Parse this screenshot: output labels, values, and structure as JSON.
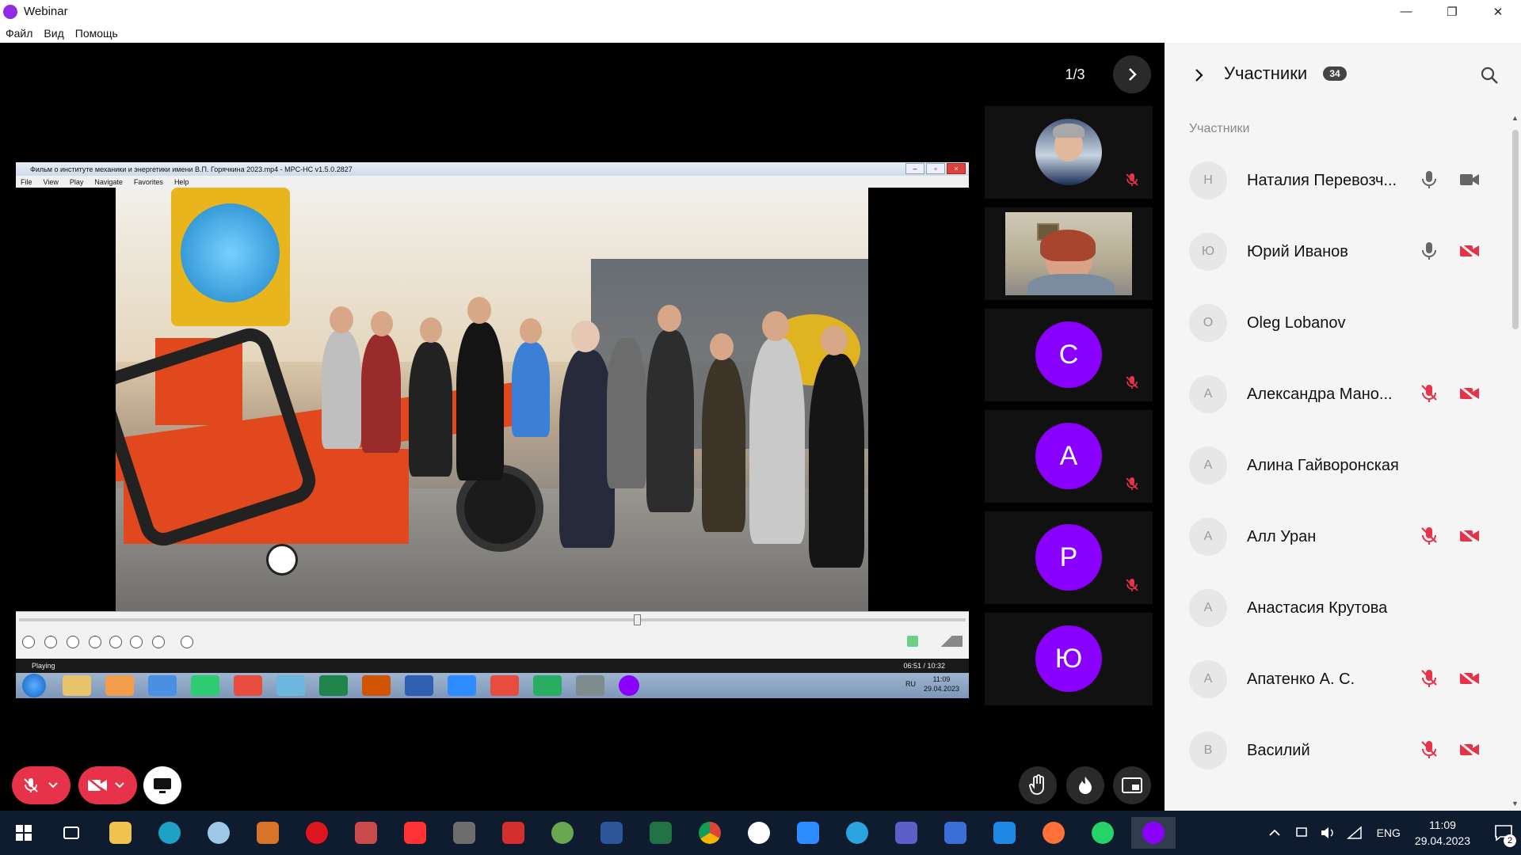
{
  "window": {
    "title": "Webinar",
    "min": "—",
    "max": "❐",
    "close": "✕"
  },
  "menu": [
    "Файл",
    "Вид",
    "Помощь"
  ],
  "gallery": {
    "page": "1/3"
  },
  "shared_screen": {
    "player_title": "Фильм о институте механики и энергетики имени В.П. Горячкина 2023.mp4 - MPC-HC v1.5.0.2827",
    "menu": [
      "File",
      "View",
      "Play",
      "Navigate",
      "Favorites",
      "Help"
    ],
    "status_left": "Playing",
    "status_right": "06:51 / 10:32",
    "seek_position": 0.649,
    "tray_lang": "RU",
    "tray_time": "11:09",
    "tray_date": "29.04.2023"
  },
  "tiles": [
    {
      "kind": "photo",
      "muted": true
    },
    {
      "kind": "camera",
      "muted": false
    },
    {
      "kind": "avatar",
      "letter": "С",
      "muted": true
    },
    {
      "kind": "avatar",
      "letter": "А",
      "muted": true
    },
    {
      "kind": "avatar",
      "letter": "Р",
      "muted": true
    },
    {
      "kind": "avatar",
      "letter": "Ю",
      "muted": false
    }
  ],
  "sidebar": {
    "title": "Участники",
    "count": "34",
    "section": "Участники",
    "participants": [
      {
        "initial": "Н",
        "name": "Наталия Перевозч...",
        "mic": "on",
        "cam": "on"
      },
      {
        "initial": "Ю",
        "name": "Юрий Иванов",
        "mic": "on",
        "cam": "off"
      },
      {
        "initial": "O",
        "name": "Oleg Lobanov",
        "mic": "none",
        "cam": "none"
      },
      {
        "initial": "А",
        "name": "Александра Мано...",
        "mic": "off",
        "cam": "off"
      },
      {
        "initial": "А",
        "name": "Алина Гайворонская",
        "mic": "none",
        "cam": "none"
      },
      {
        "initial": "А",
        "name": "Алл Уран",
        "mic": "off",
        "cam": "off"
      },
      {
        "initial": "А",
        "name": "Анастасия Крутова",
        "mic": "none",
        "cam": "none"
      },
      {
        "initial": "А",
        "name": "Апатенко А. С.",
        "mic": "off",
        "cam": "off"
      },
      {
        "initial": "В",
        "name": "Василий",
        "mic": "off",
        "cam": "off"
      }
    ]
  },
  "taskbar": {
    "lang": "ENG",
    "time": "11:09",
    "date": "29.04.2023",
    "notifications": "2"
  },
  "colors": {
    "accent": "#8a00ff",
    "danger": "#e6334a",
    "sidebar_bg": "#f5f5f5",
    "taskbar_bg": "#0f1b2e"
  }
}
